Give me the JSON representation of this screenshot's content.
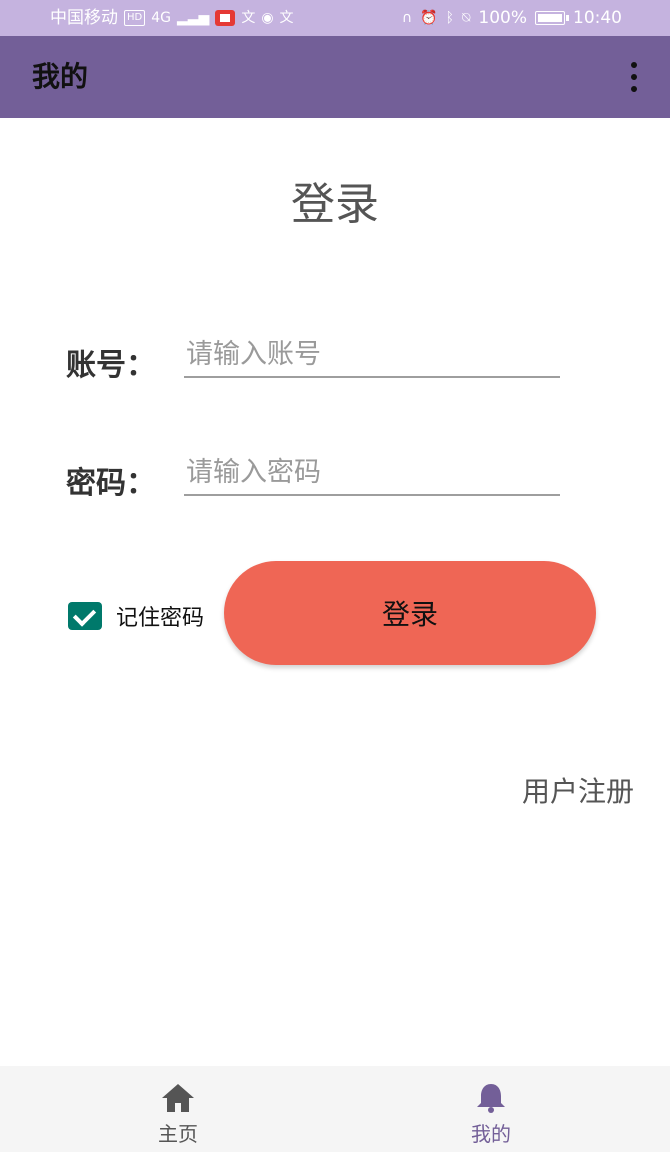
{
  "status_bar": {
    "carrier": "中国移动",
    "hd": "HD",
    "network": "4G",
    "battery": "100%",
    "time": "10:40"
  },
  "app_bar": {
    "title": "我的"
  },
  "login": {
    "title": "登录",
    "account_label": "账号：",
    "account_placeholder": "请输入账号",
    "account_value": "",
    "password_label": "密码：",
    "password_placeholder": "请输入密码",
    "password_value": "",
    "remember_label": "记住密码",
    "remember_checked": true,
    "login_button": "登录",
    "register_link": "用户注册"
  },
  "bottom_nav": {
    "items": [
      {
        "label": "主页",
        "icon": "home-icon",
        "active": false
      },
      {
        "label": "我的",
        "icon": "bell-icon",
        "active": true
      }
    ]
  },
  "colors": {
    "status_bar": "#c5b3df",
    "app_bar": "#735f98",
    "login_button": "#ef6655",
    "checkbox": "#00796b",
    "active_nav": "#735f98"
  }
}
